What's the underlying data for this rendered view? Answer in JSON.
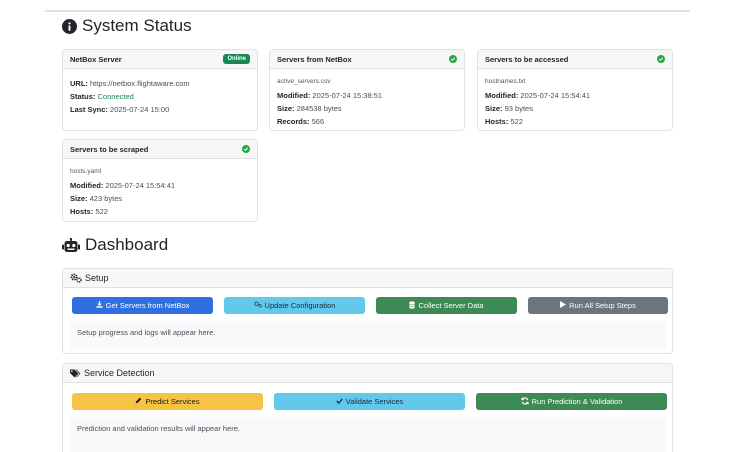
{
  "system_status": {
    "title": "System Status",
    "cards": {
      "netbox": {
        "title": "NetBox Server",
        "badge": "Online",
        "url_label": "URL:",
        "url": "https://netbox.flightaware.com",
        "status_label": "Status:",
        "status": "Connected",
        "sync_label": "Last Sync:",
        "sync": "2025-07-24 15:00"
      },
      "from_netbox": {
        "title": "Servers from NetBox",
        "file": "active_servers.csv",
        "modified_label": "Modified:",
        "modified": "2025-07-24 15:38:51",
        "size_label": "Size:",
        "size": "284538 bytes",
        "records_label": "Records:",
        "records": "566"
      },
      "accessed": {
        "title": "Servers to be accessed",
        "file": "hostnames.txt",
        "modified_label": "Modified:",
        "modified": "2025-07-24 15:54:41",
        "size_label": "Size:",
        "size": "93 bytes",
        "hosts_label": "Hosts:",
        "hosts": "522"
      },
      "scraped": {
        "title": "Servers to be scraped",
        "file": "hosts.yaml",
        "modified_label": "Modified:",
        "modified": "2025-07-24 15:54:41",
        "size_label": "Size:",
        "size": "423 bytes",
        "hosts_label": "Hosts:",
        "hosts": "522"
      }
    }
  },
  "dashboard": {
    "title": "Dashboard",
    "setup": {
      "title": "Setup",
      "buttons": {
        "get_servers": "Get Servers from NetBox",
        "update_config": "Update Configuration",
        "collect_data": "Collect Server Data",
        "run_all": "Run All Setup Steps"
      },
      "log": "Setup progress and logs will appear here."
    },
    "service_detection": {
      "title": "Service Detection",
      "buttons": {
        "predict": "Predict Services",
        "validate": "Validate Services",
        "run_both": "Run Prediction & Validation"
      },
      "log": "Prediction and validation results will appear here."
    }
  }
}
